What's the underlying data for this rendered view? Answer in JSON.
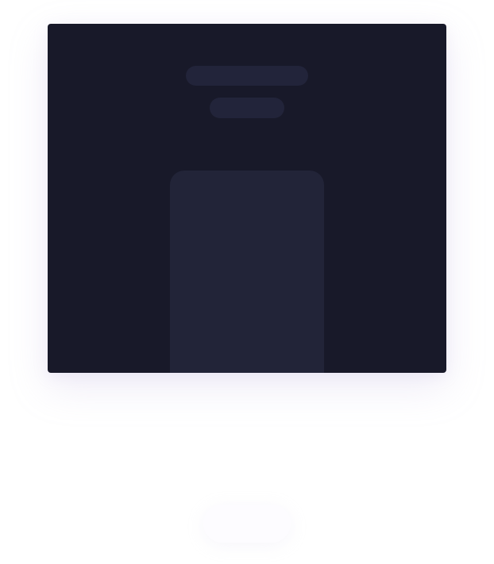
{
  "colors": {
    "card_background": "#181929",
    "skeleton_bar": "#22243a",
    "phone_body": "#222438",
    "ghost_button": "#fdfcff"
  },
  "ghost_button": {
    "label": ""
  }
}
